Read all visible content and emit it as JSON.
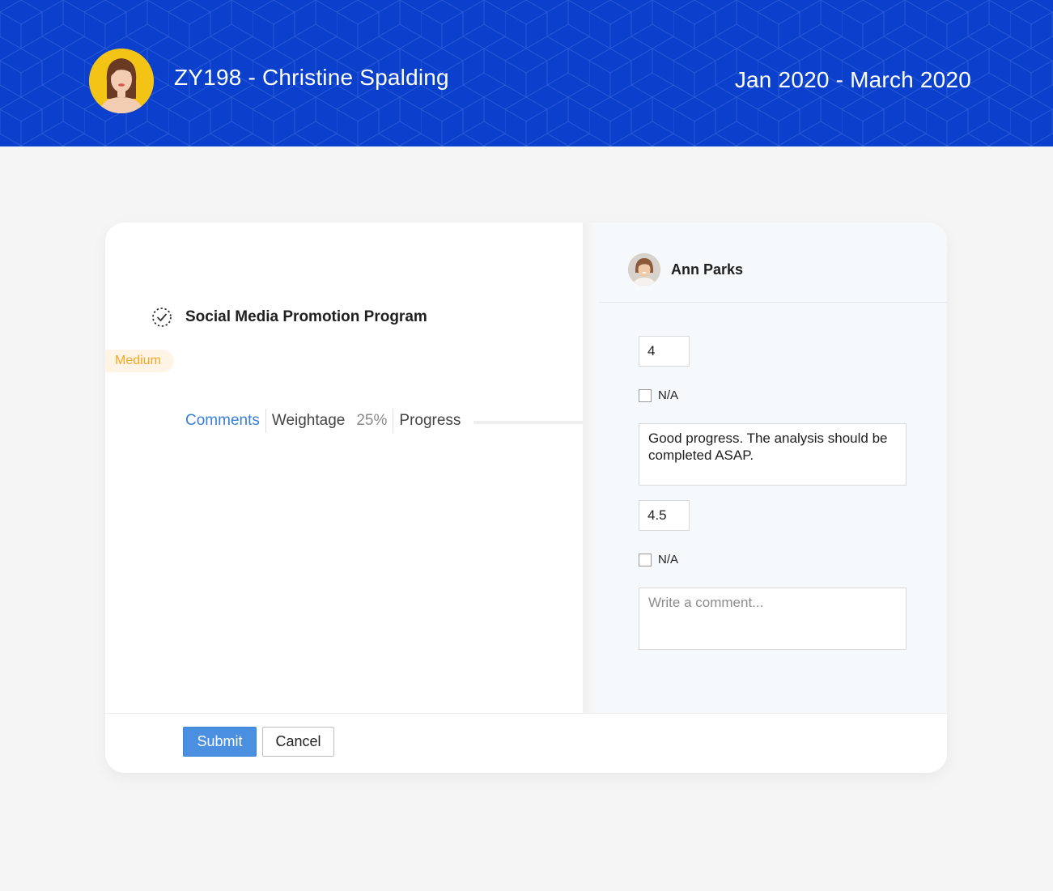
{
  "header": {
    "title": "ZY198 - Christine Spalding",
    "period": "Jan 2020 - March 2020",
    "avatar_icon": "employee-avatar",
    "background_color": "#0a40cc"
  },
  "goal": {
    "icon": "goal-check-icon",
    "title": "Social Media Promotion Program",
    "priority": "Medium",
    "meta": {
      "comments_link": "Comments",
      "weightage_label": "Weightage",
      "weightage_value": "25%",
      "progress_label": "Progress"
    }
  },
  "reviewer": {
    "name": "Ann Parks",
    "avatar_icon": "reviewer-avatar"
  },
  "ratings": [
    {
      "score": "4",
      "na_label": "N/A",
      "na_checked": false,
      "comment": "Good progress. The analysis should be completed ASAP.",
      "comment_placeholder": ""
    },
    {
      "score": "4.5",
      "na_label": "N/A",
      "na_checked": false,
      "comment": "",
      "comment_placeholder": "Write a comment..."
    }
  ],
  "footer": {
    "submit_label": "Submit",
    "cancel_label": "Cancel"
  },
  "colors": {
    "accent": "#4a8fe0",
    "link": "#3a7fd6",
    "priority_text": "#f5a623",
    "priority_bg": "#fff4e6"
  }
}
